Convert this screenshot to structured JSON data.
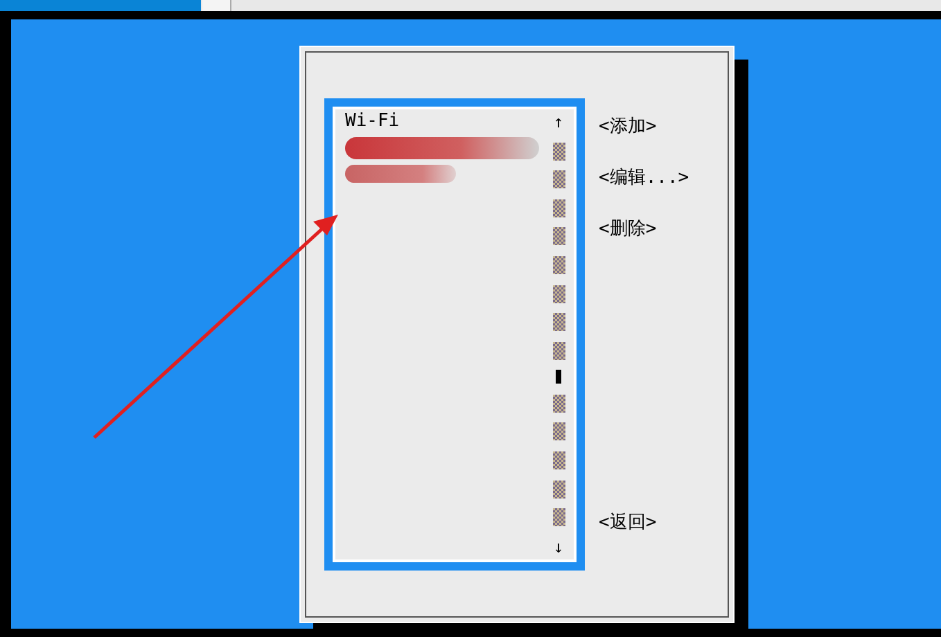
{
  "connection_list": {
    "heading": "Wi-Fi",
    "entries": [
      {
        "kind": "redacted"
      },
      {
        "kind": "redacted"
      }
    ],
    "scroll_up": "↑",
    "scroll_down": "↓"
  },
  "buttons": [
    {
      "label": "<添加>",
      "kind": "top"
    },
    {
      "label": "<编辑...>",
      "kind": "top"
    },
    {
      "label": "<删除>",
      "kind": "top"
    },
    {
      "label": "<返回>",
      "kind": "bottom"
    }
  ]
}
